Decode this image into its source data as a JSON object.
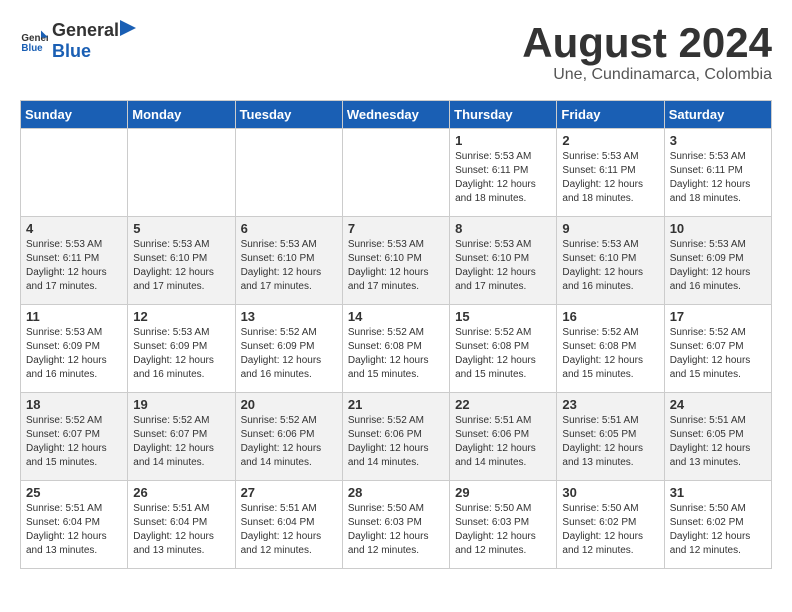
{
  "header": {
    "logo_general": "General",
    "logo_blue": "Blue",
    "main_title": "August 2024",
    "subtitle": "Une, Cundinamarca, Colombia"
  },
  "calendar": {
    "days_of_week": [
      "Sunday",
      "Monday",
      "Tuesday",
      "Wednesday",
      "Thursday",
      "Friday",
      "Saturday"
    ],
    "weeks": [
      [
        {
          "day": "",
          "info": ""
        },
        {
          "day": "",
          "info": ""
        },
        {
          "day": "",
          "info": ""
        },
        {
          "day": "",
          "info": ""
        },
        {
          "day": "1",
          "info": "Sunrise: 5:53 AM\nSunset: 6:11 PM\nDaylight: 12 hours\nand 18 minutes."
        },
        {
          "day": "2",
          "info": "Sunrise: 5:53 AM\nSunset: 6:11 PM\nDaylight: 12 hours\nand 18 minutes."
        },
        {
          "day": "3",
          "info": "Sunrise: 5:53 AM\nSunset: 6:11 PM\nDaylight: 12 hours\nand 18 minutes."
        }
      ],
      [
        {
          "day": "4",
          "info": "Sunrise: 5:53 AM\nSunset: 6:11 PM\nDaylight: 12 hours\nand 17 minutes."
        },
        {
          "day": "5",
          "info": "Sunrise: 5:53 AM\nSunset: 6:10 PM\nDaylight: 12 hours\nand 17 minutes."
        },
        {
          "day": "6",
          "info": "Sunrise: 5:53 AM\nSunset: 6:10 PM\nDaylight: 12 hours\nand 17 minutes."
        },
        {
          "day": "7",
          "info": "Sunrise: 5:53 AM\nSunset: 6:10 PM\nDaylight: 12 hours\nand 17 minutes."
        },
        {
          "day": "8",
          "info": "Sunrise: 5:53 AM\nSunset: 6:10 PM\nDaylight: 12 hours\nand 17 minutes."
        },
        {
          "day": "9",
          "info": "Sunrise: 5:53 AM\nSunset: 6:10 PM\nDaylight: 12 hours\nand 16 minutes."
        },
        {
          "day": "10",
          "info": "Sunrise: 5:53 AM\nSunset: 6:09 PM\nDaylight: 12 hours\nand 16 minutes."
        }
      ],
      [
        {
          "day": "11",
          "info": "Sunrise: 5:53 AM\nSunset: 6:09 PM\nDaylight: 12 hours\nand 16 minutes."
        },
        {
          "day": "12",
          "info": "Sunrise: 5:53 AM\nSunset: 6:09 PM\nDaylight: 12 hours\nand 16 minutes."
        },
        {
          "day": "13",
          "info": "Sunrise: 5:52 AM\nSunset: 6:09 PM\nDaylight: 12 hours\nand 16 minutes."
        },
        {
          "day": "14",
          "info": "Sunrise: 5:52 AM\nSunset: 6:08 PM\nDaylight: 12 hours\nand 15 minutes."
        },
        {
          "day": "15",
          "info": "Sunrise: 5:52 AM\nSunset: 6:08 PM\nDaylight: 12 hours\nand 15 minutes."
        },
        {
          "day": "16",
          "info": "Sunrise: 5:52 AM\nSunset: 6:08 PM\nDaylight: 12 hours\nand 15 minutes."
        },
        {
          "day": "17",
          "info": "Sunrise: 5:52 AM\nSunset: 6:07 PM\nDaylight: 12 hours\nand 15 minutes."
        }
      ],
      [
        {
          "day": "18",
          "info": "Sunrise: 5:52 AM\nSunset: 6:07 PM\nDaylight: 12 hours\nand 15 minutes."
        },
        {
          "day": "19",
          "info": "Sunrise: 5:52 AM\nSunset: 6:07 PM\nDaylight: 12 hours\nand 14 minutes."
        },
        {
          "day": "20",
          "info": "Sunrise: 5:52 AM\nSunset: 6:06 PM\nDaylight: 12 hours\nand 14 minutes."
        },
        {
          "day": "21",
          "info": "Sunrise: 5:52 AM\nSunset: 6:06 PM\nDaylight: 12 hours\nand 14 minutes."
        },
        {
          "day": "22",
          "info": "Sunrise: 5:51 AM\nSunset: 6:06 PM\nDaylight: 12 hours\nand 14 minutes."
        },
        {
          "day": "23",
          "info": "Sunrise: 5:51 AM\nSunset: 6:05 PM\nDaylight: 12 hours\nand 13 minutes."
        },
        {
          "day": "24",
          "info": "Sunrise: 5:51 AM\nSunset: 6:05 PM\nDaylight: 12 hours\nand 13 minutes."
        }
      ],
      [
        {
          "day": "25",
          "info": "Sunrise: 5:51 AM\nSunset: 6:04 PM\nDaylight: 12 hours\nand 13 minutes."
        },
        {
          "day": "26",
          "info": "Sunrise: 5:51 AM\nSunset: 6:04 PM\nDaylight: 12 hours\nand 13 minutes."
        },
        {
          "day": "27",
          "info": "Sunrise: 5:51 AM\nSunset: 6:04 PM\nDaylight: 12 hours\nand 12 minutes."
        },
        {
          "day": "28",
          "info": "Sunrise: 5:50 AM\nSunset: 6:03 PM\nDaylight: 12 hours\nand 12 minutes."
        },
        {
          "day": "29",
          "info": "Sunrise: 5:50 AM\nSunset: 6:03 PM\nDaylight: 12 hours\nand 12 minutes."
        },
        {
          "day": "30",
          "info": "Sunrise: 5:50 AM\nSunset: 6:02 PM\nDaylight: 12 hours\nand 12 minutes."
        },
        {
          "day": "31",
          "info": "Sunrise: 5:50 AM\nSunset: 6:02 PM\nDaylight: 12 hours\nand 12 minutes."
        }
      ]
    ]
  }
}
